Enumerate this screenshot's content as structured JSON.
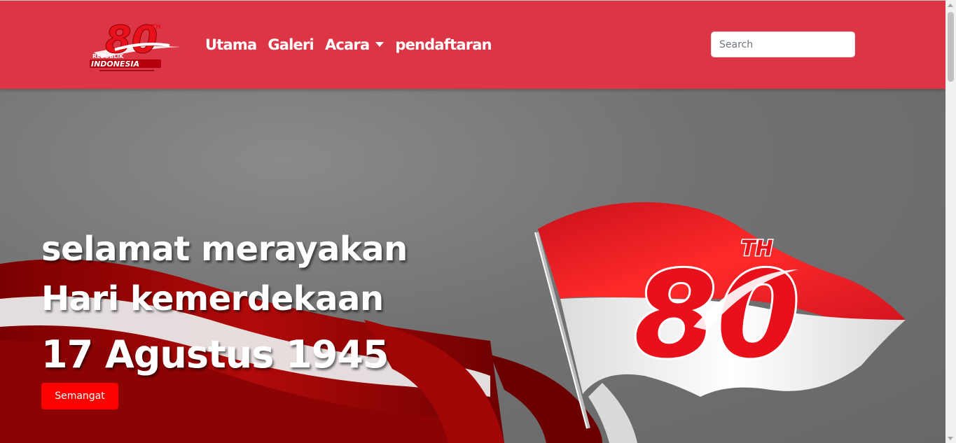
{
  "navbar": {
    "logo": {
      "icon": "hut-ri-80-logo",
      "number": "80",
      "suffix": "TH",
      "line1": "REPUBLIK",
      "line2": "INDONESIA"
    },
    "links": [
      {
        "label": "Utama"
      },
      {
        "label": "Galeri"
      },
      {
        "label": "Acara",
        "has_dropdown": true
      },
      {
        "label": "pendaftaran"
      }
    ],
    "search": {
      "placeholder": "Search",
      "value": ""
    },
    "color": "#dc3545"
  },
  "hero": {
    "title_line1": "selamat merayakan",
    "title_line2": "Hari kemerdekaan",
    "title_line3": "17 Agustus 1945",
    "button_label": "Semangat",
    "button_color": "#ff0000",
    "art": {
      "flag_icon": "indonesian-flag-icon",
      "ribbon_icon": "red-white-ribbon",
      "badge_number": "80",
      "badge_suffix": "TH"
    }
  }
}
